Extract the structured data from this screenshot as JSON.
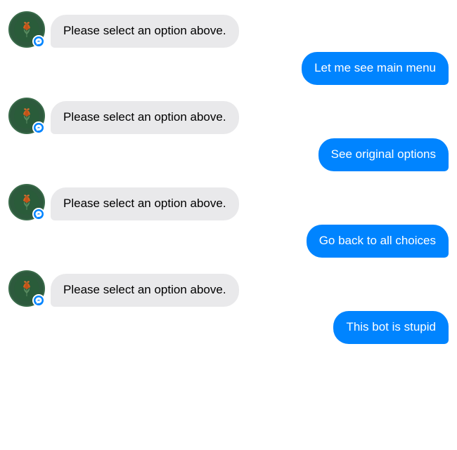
{
  "messages": [
    {
      "id": "bot1",
      "type": "bot",
      "text": "Please select an option above."
    },
    {
      "id": "user1",
      "type": "user",
      "text": "Let me see main menu"
    },
    {
      "id": "bot2",
      "type": "bot",
      "text": "Please select an option above."
    },
    {
      "id": "user2",
      "type": "user",
      "text": "See original options"
    },
    {
      "id": "bot3",
      "type": "bot",
      "text": "Please select an option above."
    },
    {
      "id": "user3",
      "type": "user",
      "text": "Go back to all choices"
    },
    {
      "id": "bot4",
      "type": "bot",
      "text": "Please select an option above."
    },
    {
      "id": "user4",
      "type": "user",
      "text": "This bot is stupid"
    }
  ]
}
